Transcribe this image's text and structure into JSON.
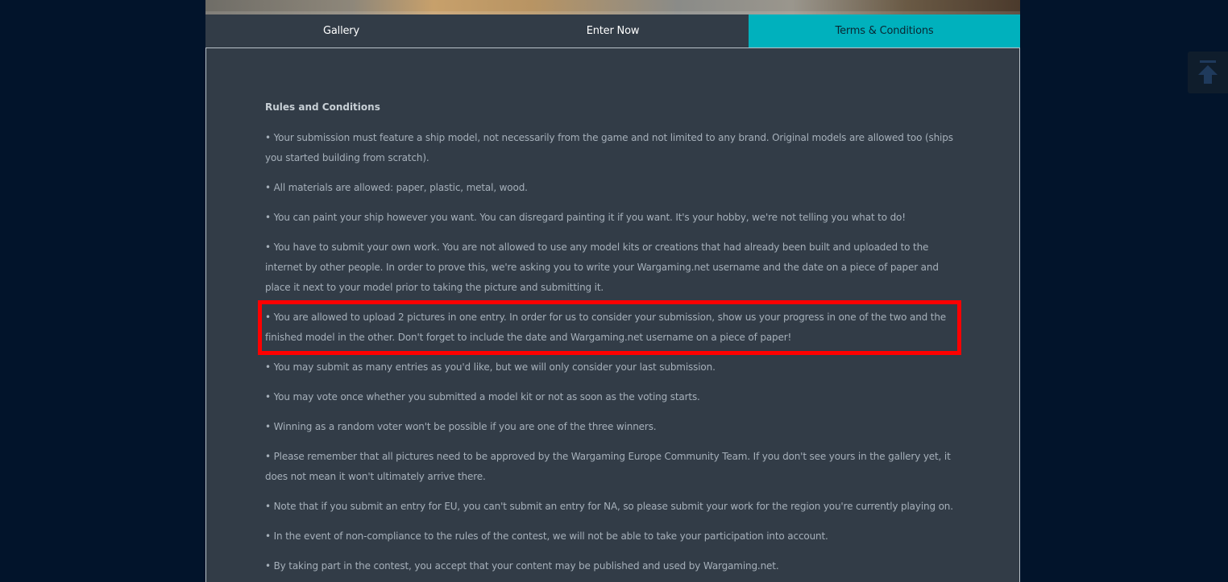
{
  "tabs": [
    {
      "label": "Gallery"
    },
    {
      "label": "Enter Now"
    },
    {
      "label": "Terms & Conditions"
    }
  ],
  "content": {
    "heading": "Rules and Conditions",
    "rules": [
      "• Your submission must feature a ship model, not necessarily from the game and not limited to any brand. Original models are allowed too (ships you started building from scratch).",
      "• All materials are allowed: paper, plastic, metal, wood.",
      "• You can paint your ship however you want. You can disregard painting it if you want. It's your hobby, we're not telling you what to do!",
      "• You have to submit your own work. You are not allowed to use any model kits or creations that had already been built and uploaded to the internet by other people. In order to prove this, we're asking you to write your Wargaming.net username and the date on a piece of paper and place it next to your model prior to taking the picture and submitting it.",
      "• You are allowed to upload 2 pictures in one entry. In order for us to consider your submission, show us your progress in one of the two and the finished model in the other. Don't forget to include the date and Wargaming.net username on a piece of paper!",
      "• You may submit as many entries as you'd like, but we will only consider your last submission.",
      "• You may vote once whether you submitted a model kit or not as soon as the voting starts.",
      "• Winning as a random voter won't be possible if you are one of the three winners.",
      "• Please remember that all pictures need to be approved by the Wargaming Europe Community Team. If you don't see yours in the gallery yet, it does not mean it won't ultimately arrive there.",
      "• Note that if you submit an entry for EU, you can't submit an entry for NA, so please submit your work for the region you're currently playing on.",
      "• In the event of non-compliance to the rules of the contest, we will not be able to take your participation into account.",
      "• By taking part in the contest, you accept that your content may be published and used by Wargaming.net."
    ]
  },
  "scroll_top": {
    "icon": "arrow-up-icon"
  },
  "colors": {
    "background": "#02142b",
    "panel": "#323c47",
    "active_tab": "#00b1bd",
    "highlight": "#ff0000"
  }
}
